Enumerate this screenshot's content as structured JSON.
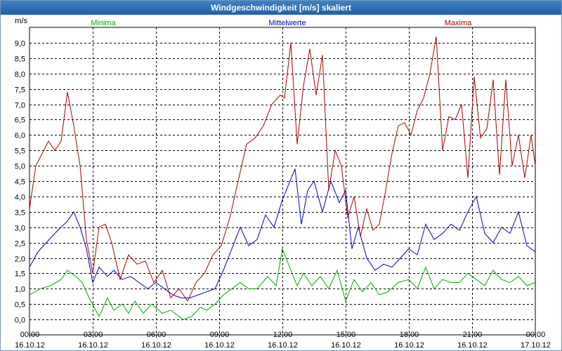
{
  "window": {
    "title": "Windgeschwindigkeit [m/s] skaliert"
  },
  "chart_data": {
    "type": "line",
    "title": "Windgeschwindigkeit [m/s] skaliert",
    "ylabel": "m/s",
    "ylim": [
      -0.5,
      9.5
    ],
    "yticks": [
      0.0,
      0.5,
      1.0,
      1.5,
      2.0,
      2.5,
      3.0,
      3.5,
      4.0,
      4.5,
      5.0,
      5.5,
      6.0,
      6.5,
      7.0,
      7.5,
      8.0,
      8.5,
      9.0
    ],
    "ytick_labels": [
      "0,0",
      "0,5",
      "1,0",
      "1,5",
      "2,0",
      "2,5",
      "3,0",
      "3,5",
      "4,0",
      "4,5",
      "5,0",
      "5,5",
      "6,0",
      "6,5",
      "7,0",
      "7,5",
      "8,0",
      "8,5",
      "9,0"
    ],
    "xlim": [
      0,
      24
    ],
    "xticks": [
      0,
      3,
      6,
      9,
      12,
      15,
      18,
      21,
      24
    ],
    "xtick_labels": [
      [
        "00:00",
        "16.10.12"
      ],
      [
        "03:00",
        "16.10.12"
      ],
      [
        "06:00",
        "16.10.12"
      ],
      [
        "09:00",
        "16.10.12"
      ],
      [
        "12:00",
        "16.10.12"
      ],
      [
        "15:00",
        "16.10.12"
      ],
      [
        "18:00",
        "16.10.12"
      ],
      [
        "21:00",
        "16.10.12"
      ],
      [
        "00:00",
        "17.10.12"
      ]
    ],
    "grid": true,
    "legend_position": "top",
    "series": [
      {
        "name": "Minima",
        "color": "#00aa00",
        "x": [
          0,
          0.5,
          1,
          1.5,
          1.8,
          2.2,
          2.5,
          2.9,
          3.3,
          3.7,
          4,
          4.4,
          4.7,
          5,
          5.4,
          5.8,
          6.3,
          6.7,
          7.3,
          7.7,
          8.1,
          8.4,
          8.8,
          9.2,
          9.6,
          10,
          10.4,
          10.8,
          11.3,
          11.7,
          12,
          12.4,
          12.7,
          13,
          13.4,
          13.8,
          14.2,
          14.6,
          15,
          15.4,
          15.8,
          16.2,
          16.6,
          17,
          17.5,
          18,
          18.4,
          18.8,
          19.2,
          19.6,
          20,
          20.4,
          20.8,
          21.2,
          21.6,
          22,
          22.4,
          22.8,
          23.2,
          23.6,
          24
        ],
        "y": [
          0.8,
          1.0,
          1.1,
          1.3,
          1.6,
          1.4,
          1.2,
          0.6,
          0.1,
          0.7,
          0.3,
          0.5,
          0.2,
          0.6,
          0.2,
          0.5,
          0.2,
          0.3,
          0.0,
          0.1,
          0.4,
          0.3,
          0.5,
          0.8,
          1.0,
          1.2,
          1.0,
          1.0,
          1.4,
          1.1,
          2.3,
          1.6,
          1.1,
          1.5,
          1.1,
          1.4,
          1.0,
          1.6,
          0.6,
          1.3,
          0.9,
          1.2,
          0.8,
          0.9,
          1.2,
          1.3,
          1.0,
          1.7,
          1.0,
          1.3,
          1.2,
          1.2,
          1.5,
          1.3,
          1.1,
          1.6,
          1.3,
          1.2,
          1.4,
          1.1,
          1.2
        ]
      },
      {
        "name": "Mittelwerte",
        "color": "#0000cc",
        "x": [
          0,
          0.4,
          0.8,
          1.2,
          1.5,
          1.8,
          2.1,
          2.4,
          2.7,
          3,
          3.3,
          3.7,
          4,
          4.4,
          4.8,
          5.2,
          5.6,
          6,
          6.4,
          6.8,
          7.2,
          7.6,
          8,
          8.4,
          8.8,
          9.2,
          9.6,
          10,
          10.4,
          10.8,
          11.2,
          11.6,
          12,
          12.3,
          12.6,
          12.9,
          13.2,
          13.5,
          13.9,
          14.3,
          14.7,
          15,
          15.3,
          15.6,
          16,
          16.4,
          16.8,
          17.2,
          17.6,
          18,
          18.4,
          18.8,
          19.2,
          19.6,
          20,
          20.4,
          20.8,
          21.2,
          21.6,
          22,
          22.4,
          22.8,
          23.2,
          23.6,
          24
        ],
        "y": [
          1.7,
          2.2,
          2.5,
          2.8,
          3.0,
          3.2,
          3.5,
          3.0,
          2.3,
          1.2,
          1.7,
          1.4,
          1.6,
          1.3,
          1.4,
          1.2,
          1.0,
          1.2,
          1.0,
          0.8,
          0.7,
          0.7,
          0.8,
          0.9,
          1.0,
          1.6,
          2.3,
          3.0,
          2.4,
          2.6,
          3.4,
          3.0,
          3.9,
          4.4,
          4.9,
          3.1,
          4.2,
          4.5,
          3.5,
          4.5,
          3.8,
          4.2,
          2.3,
          3.0,
          2.0,
          1.6,
          1.8,
          1.7,
          2.0,
          2.3,
          2.1,
          3.1,
          2.6,
          2.8,
          3.1,
          2.9,
          3.5,
          4.0,
          2.8,
          2.5,
          3.0,
          2.8,
          3.5,
          2.4,
          2.2
        ]
      },
      {
        "name": "Maxima",
        "color": "#aa0000",
        "x": [
          0,
          0.3,
          0.6,
          0.9,
          1.2,
          1.5,
          1.8,
          2.1,
          2.4,
          2.7,
          3,
          3.3,
          3.6,
          3.9,
          4.3,
          4.7,
          5.1,
          5.5,
          5.9,
          6.3,
          6.7,
          7.1,
          7.5,
          7.9,
          8.3,
          8.7,
          9.1,
          9.5,
          9.9,
          10.3,
          10.7,
          11.1,
          11.5,
          11.9,
          12.1,
          12.4,
          12.7,
          13,
          13.3,
          13.6,
          13.9,
          14.2,
          14.5,
          14.8,
          15.1,
          15.4,
          15.7,
          16,
          16.3,
          16.6,
          16.9,
          17.2,
          17.5,
          17.8,
          18.1,
          18.4,
          18.7,
          19,
          19.3,
          19.6,
          19.9,
          20.2,
          20.5,
          20.8,
          21.1,
          21.4,
          21.7,
          22,
          22.3,
          22.6,
          22.9,
          23.2,
          23.5,
          23.8,
          24
        ],
        "y": [
          3.6,
          5.0,
          5.4,
          5.8,
          5.5,
          5.8,
          7.4,
          6.3,
          5.0,
          2.6,
          1.5,
          3.0,
          3.1,
          2.5,
          1.3,
          2.1,
          1.8,
          1.9,
          1.2,
          1.6,
          0.7,
          1.0,
          0.6,
          1.2,
          1.5,
          2.1,
          2.4,
          3.3,
          4.5,
          5.7,
          5.9,
          6.3,
          7.0,
          7.3,
          7.2,
          9.0,
          5.7,
          7.6,
          8.8,
          7.3,
          8.6,
          4.2,
          5.5,
          5.0,
          3.3,
          4.0,
          2.7,
          3.6,
          2.9,
          3.1,
          4.2,
          5.4,
          6.3,
          6.4,
          6.0,
          6.8,
          7.2,
          8.0,
          9.2,
          5.5,
          6.6,
          6.5,
          7.0,
          4.6,
          7.9,
          5.9,
          6.2,
          7.8,
          4.7,
          7.8,
          5.0,
          6.0,
          4.6,
          6.0,
          5.0
        ]
      }
    ]
  }
}
